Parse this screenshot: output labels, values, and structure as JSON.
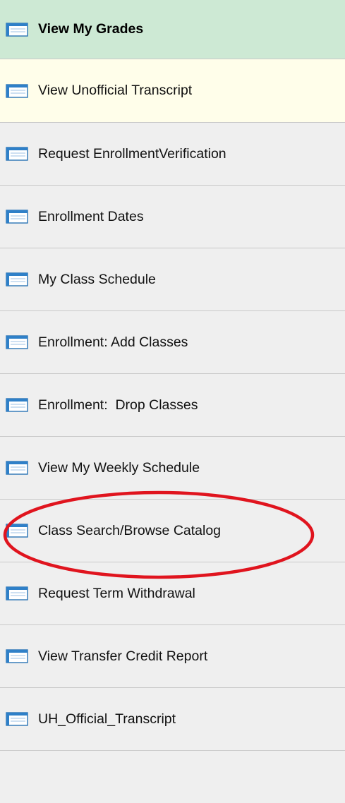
{
  "menu": {
    "items": [
      {
        "label": "View My Grades",
        "icon": "page-icon",
        "state": "selected"
      },
      {
        "label": "View Unofficial Transcript",
        "icon": "page-icon",
        "state": "hover"
      },
      {
        "label": "Request EnrollmentVerification",
        "icon": "page-icon",
        "state": "normal"
      },
      {
        "label": "Enrollment Dates",
        "icon": "page-icon",
        "state": "normal"
      },
      {
        "label": "My Class Schedule",
        "icon": "page-icon",
        "state": "normal"
      },
      {
        "label": "Enrollment: Add Classes",
        "icon": "page-icon",
        "state": "normal"
      },
      {
        "label": "Enrollment:  Drop Classes",
        "icon": "page-icon",
        "state": "normal"
      },
      {
        "label": "View My Weekly Schedule",
        "icon": "page-icon",
        "state": "normal"
      },
      {
        "label": "Class Search/Browse Catalog",
        "icon": "page-icon",
        "state": "normal",
        "highlighted": true
      },
      {
        "label": "Request Term Withdrawal",
        "icon": "page-icon",
        "state": "normal"
      },
      {
        "label": "View Transfer Credit Report",
        "icon": "page-icon",
        "state": "normal"
      },
      {
        "label": "UH_Official_Transcript",
        "icon": "page-icon",
        "state": "normal"
      }
    ]
  },
  "colors": {
    "selected_bg": "#cde9d4",
    "hover_bg": "#fffeea",
    "row_bg": "#efefef",
    "divider": "#c9c9c9",
    "annotation": "#e0141e"
  }
}
